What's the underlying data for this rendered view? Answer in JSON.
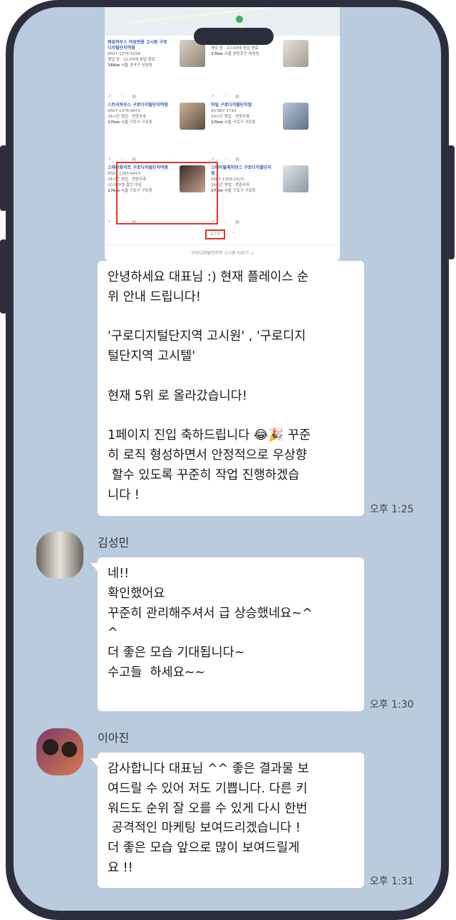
{
  "screenshot": {
    "results": [
      {
        "title": "엔유하우스 여성전용 고시원 구로디지털단지역점",
        "phone": "0507-1376-5034",
        "hours": "영업 중 · 22:00에 영업 종료",
        "distance": "166m",
        "address": "서울 관악구 신림동"
      },
      {
        "title": "",
        "phone": "0507-1466-2950",
        "hours": "영업 중 · 22:00에 영업 종료",
        "distance": "17km",
        "address": "서울 영등포구 대림동"
      },
      {
        "title": "스트리하우스 구로디지털단지역점",
        "phone": "0507-1376-8970",
        "hours": "24시간 영업 · 연중무휴",
        "distance": "17km",
        "address": "서울 구로구 구로동"
      },
      {
        "title": "마일 구로디지털단지점",
        "phone": "02-867-1714",
        "hours": "24시간 영업 · 연중무휴",
        "distance": "17km",
        "address": "서울 구로구 구로동"
      },
      {
        "title": "스테이화이트 구로디지털단지역점",
        "phone": "0507-1365-6415",
        "hours": "24시간 영업 · 연중무휴",
        "distance": "17km",
        "address": "서울 구로구 구로동",
        "promo": "10,000원 할인 쿠폰"
      },
      {
        "title": "스테이힐레지던스 구로디지털단지점",
        "phone": "0507-1358-1523",
        "hours": "24시간 영업 · 연중무휴",
        "distance": "17km",
        "address": "서울 구로구 구로동"
      }
    ],
    "pager": "1 / 5",
    "more_link": "구로디지털단지역 고시원 더보기 →"
  },
  "messages": [
    {
      "text": "안녕하세요 대표님 :) 현재 플레이스 순\n위 안내 드립니다!\n\n'구로디지털단지역 고시원' , '구로디지\n털단지역 고시텔'\n\n현재 5위 로 올라갔습니다!\n\n1페이지 진입 축하드립니다 😂🎉 꾸준\n히 로직 형성하면서 안정적으로 우상향\n 할수 있도록 꾸준히 작업 진행하겠습\n니다 !",
      "time": "오후 1:25"
    },
    {
      "sender": "김성민",
      "text": "네!!\n확인했어요\n꾸준히 관리해주셔서 급 상승했네요~^\n^\n더 좋은 모습 기대됩니다~\n수고들  하세요~~",
      "time": "오후 1:30"
    },
    {
      "sender": "이아진",
      "text": "감사합니다 대표님 ^^ 좋은 결과물 보\n여드릴 수 있어 저도 기쁩니다. 다른 키\n워드도 순위 잘 오를 수 있게 다시 한번\n 공격적인 마케팅 보여드리겠습니다 !\n더 좋은 모습 앞으로 많이 보여드릴게\n요 !!",
      "time": "오후 1:31"
    }
  ],
  "colors": {
    "chat_background": "#b9cbdd",
    "phone_frame": "#2c2e3e",
    "bubble": "#ffffff",
    "highlight": "#e0332f"
  }
}
